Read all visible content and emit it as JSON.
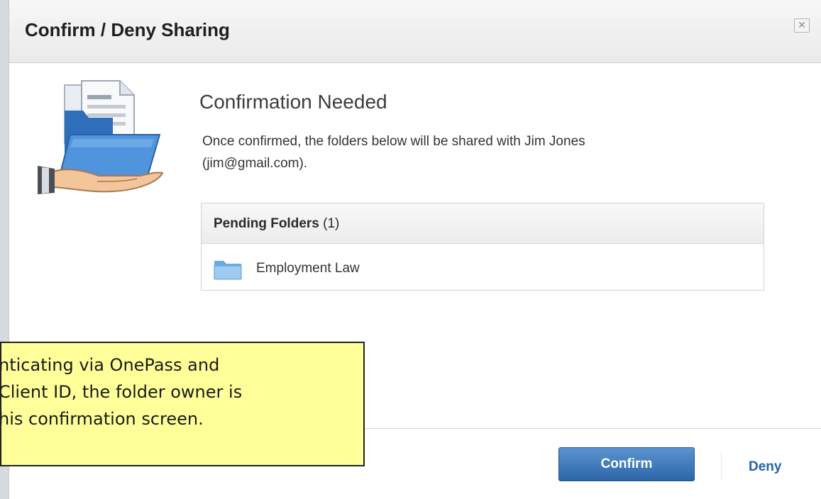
{
  "dialog": {
    "title": "Confirm / Deny Sharing",
    "close_icon": "close-icon",
    "illustration_icon": "shared-folder-hand-icon"
  },
  "confirmation": {
    "heading": "Confirmation Needed",
    "message_line1": "Once confirmed, the folders below will be shared with Jim Jones",
    "message_line2": "(jim@gmail.com)."
  },
  "pending": {
    "header_label": "Pending Folders",
    "header_count": " (1)",
    "folders": [
      {
        "name": "Employment Law",
        "icon": "folder-icon"
      }
    ]
  },
  "actions": {
    "confirm_label": "Confirm",
    "deny_label": "Deny"
  },
  "callout": {
    "line1": "nticating via OnePass and",
    "line2": "Client ID, the folder owner is",
    "line3": "his confirmation screen."
  },
  "colors": {
    "accent_blue": "#2c66a8",
    "link_blue": "#2363ad",
    "callout_bg": "#ffff99"
  }
}
